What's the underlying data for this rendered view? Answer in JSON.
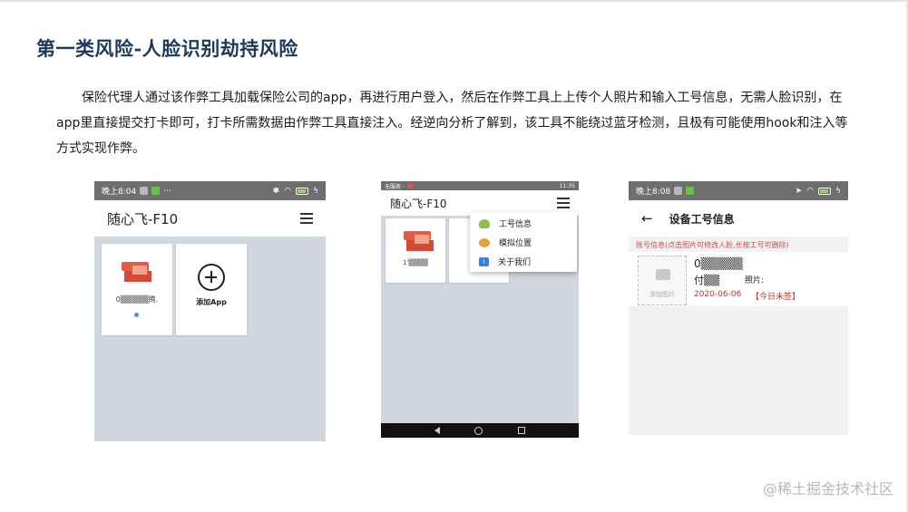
{
  "heading": "第一类风险-人脸识别劫持风险",
  "paragraph": "保险代理人通过该作弊工具加载保险公司的app，再进行用户登入，然后在作弊工具上上传个人照片和输入工号信息，无需人脸识别，在app里直接提交打卡即可，打卡所需数据由作弊工具直接注入。经逆向分析了解到，该工具不能绕过蓝牙检测，且极有可能使用hook和注入等方式实现作弊。",
  "phone1": {
    "status_time": "晚上8:04",
    "status_dots": "···",
    "app_title": "随心飞-F10",
    "card1_label": "0▒▒▒▒▒腾.",
    "card2_label": "添加App"
  },
  "phone2": {
    "status_left": "无服务 ·",
    "status_right": "11:35",
    "app_title": "随心飞-F10",
    "card1_label": "1'▒▒▒▒",
    "menu": [
      "工号信息",
      "模拟位置",
      "关于我们"
    ]
  },
  "phone3": {
    "status_time": "晚上8:08",
    "title": "设备工号信息",
    "hint": "账号信息(点击图片可修改人脸,长按工号可删除)",
    "photo_label": "添加图片",
    "id_value": "0▒▒▒▒▒",
    "name_value": "付▒▒",
    "photo_field_label": "照片:",
    "date": "2020-06-06",
    "sign_status": "【今日未签】"
  },
  "watermark": "@稀土掘金技术社区",
  "colors": {
    "heading": "#1d3a5a",
    "accent_red": "#c0392b",
    "grey_bg": "#d2d6df"
  }
}
